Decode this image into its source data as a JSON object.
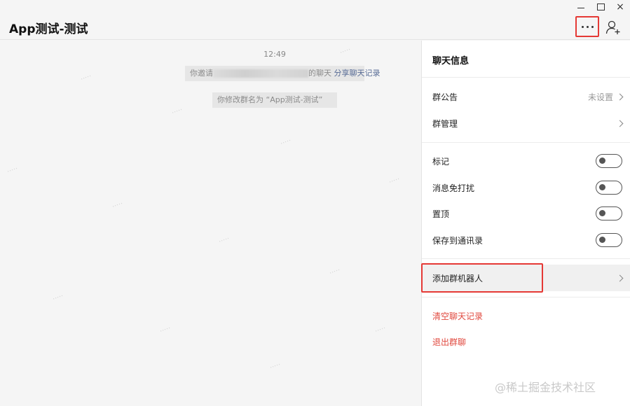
{
  "window": {
    "title": "App测试-测试",
    "controls": {
      "minimize": "minimize-icon",
      "maximize": "maximize-icon",
      "close": "×"
    }
  },
  "header": {
    "more_icon": "more-dots-icon",
    "add_member_icon": "add-user-icon"
  },
  "chat": {
    "time": "12:49",
    "msg1_prefix": "你邀请",
    "msg1_suffix": "的聊天",
    "msg1_link": "分享聊天记录",
    "msg2": "你修改群名为 “App测试-测试”"
  },
  "panel": {
    "title": "聊天信息",
    "announcement_label": "群公告",
    "announcement_value": "未设置",
    "manage_label": "群管理",
    "mark_label": "标记",
    "mute_label": "消息免打扰",
    "pin_label": "置顶",
    "save_label": "保存到通讯录",
    "add_bot_label": "添加群机器人",
    "clear_label": "清空聊天记录",
    "quit_label": "退出群聊"
  },
  "watermark": "@稀土掘金技术社区",
  "colors": {
    "danger": "#e0483e",
    "link": "#576b95",
    "highlight_border": "#e53935"
  }
}
